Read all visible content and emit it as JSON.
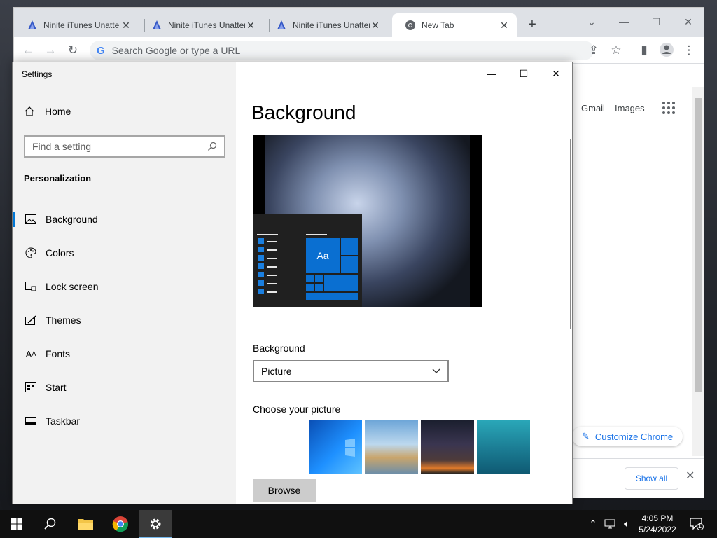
{
  "chrome": {
    "tabs": [
      {
        "title": "Ninite iTunes Unattended",
        "active": false
      },
      {
        "title": "Ninite iTunes Unattended",
        "active": false
      },
      {
        "title": "Ninite iTunes Unattended",
        "active": false
      },
      {
        "title": "New Tab",
        "active": true
      }
    ],
    "omnibox_placeholder": "Search Google or type a URL",
    "google_letter": "G",
    "links": {
      "gmail": "Gmail",
      "images": "Images"
    },
    "customize_label": "Customize Chrome",
    "show_all_label": "Show all"
  },
  "settings": {
    "app_title": "Settings",
    "home_label": "Home",
    "search_placeholder": "Find a setting",
    "section_title": "Personalization",
    "nav": [
      {
        "label": "Background",
        "icon": "picture-icon",
        "selected": true
      },
      {
        "label": "Colors",
        "icon": "palette-icon",
        "selected": false
      },
      {
        "label": "Lock screen",
        "icon": "lock-screen-icon",
        "selected": false
      },
      {
        "label": "Themes",
        "icon": "themes-icon",
        "selected": false
      },
      {
        "label": "Fonts",
        "icon": "fonts-icon",
        "selected": false
      },
      {
        "label": "Start",
        "icon": "start-icon",
        "selected": false
      },
      {
        "label": "Taskbar",
        "icon": "taskbar-icon",
        "selected": false
      }
    ],
    "page_title": "Background",
    "preview_tile_text": "Aa",
    "background_label": "Background",
    "background_value": "Picture",
    "choose_label": "Choose your picture",
    "browse_label": "Browse"
  },
  "taskbar": {
    "time": "4:05 PM",
    "date": "5/24/2022",
    "notification_count": "1"
  },
  "colors": {
    "accent": "#0078d7",
    "chrome_link": "#1a73e8",
    "taskbar": "#101010"
  }
}
